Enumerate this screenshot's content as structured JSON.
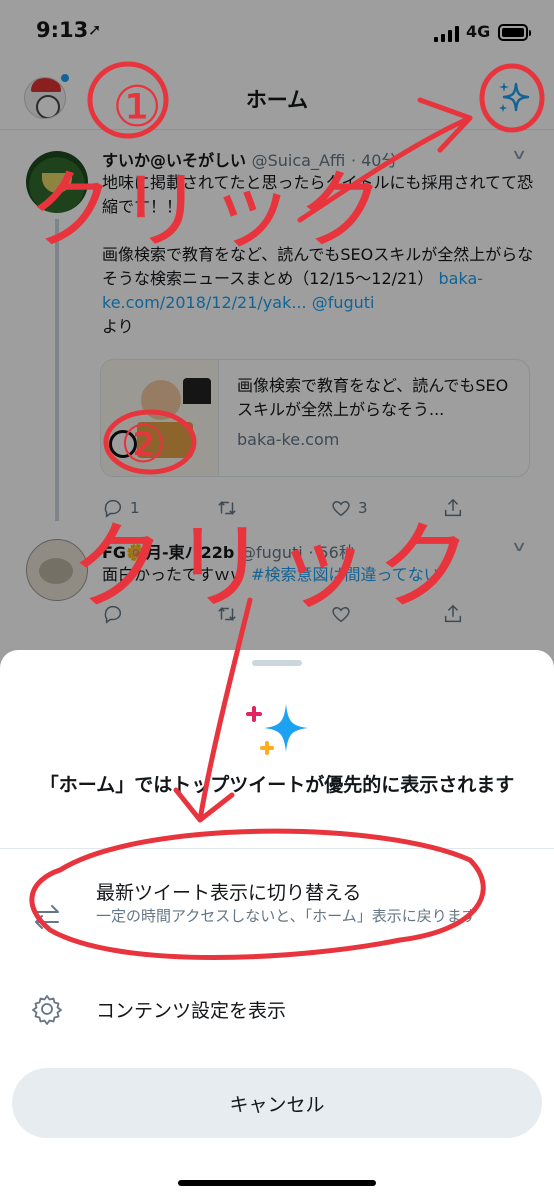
{
  "status_bar": {
    "time": "9:13",
    "location_arrow": "➚",
    "network": "4G"
  },
  "header": {
    "title": "ホーム",
    "sparkle_icon": "sparkle-icon",
    "avatar_icon": "avatar"
  },
  "tweets": [
    {
      "name": "すいか@いそがしい",
      "handle": "@Suica_Affi",
      "time": "· 40分",
      "text_line1": "地味に掲載されてたと思ったらタイトルにも採用されてて恐縮です！！",
      "text_line2": "画像検索で教育をなど、読んでもSEOスキルが全然上がらなそうな検索ニュースまとめ（12/15〜12/21）",
      "link_url": "baka-ke.com/2018/12/21/yak...",
      "mention": "@fuguti",
      "text_suffix": "より",
      "card": {
        "title": "画像検索で教育をなど、読んでもSEOスキルが全然上がらなそう...",
        "domain": "baka-ke.com"
      },
      "actions": {
        "reply_count": "1",
        "retweet_count": "",
        "like_count": "3"
      }
    },
    {
      "name": "FG🌼月-東ハ22b",
      "handle": "@fuguti",
      "time": "· 56秒",
      "text": "面白かったですｗｗ",
      "hashtag": "#検索意図は間違ってない",
      "actions": {
        "reply_count": "",
        "retweet_count": "",
        "like_count": ""
      }
    }
  ],
  "sheet": {
    "heading": "「ホーム」ではトップツイートが優先的に表示されます",
    "option_latest": {
      "label": "最新ツイート表示に切り替える",
      "sublabel": "一定の時間アクセスしないと、「ホーム」表示に戻ります",
      "icon": "swap-arrows-icon"
    },
    "option_content": {
      "label": "コンテンツ設定を表示",
      "icon": "gear-icon"
    },
    "cancel_label": "キャンセル"
  },
  "annotations": {
    "color": "#e8343c",
    "step1_number": "①",
    "step1_text": "クリック",
    "step2_number": "②",
    "step2_text": "クリック"
  }
}
